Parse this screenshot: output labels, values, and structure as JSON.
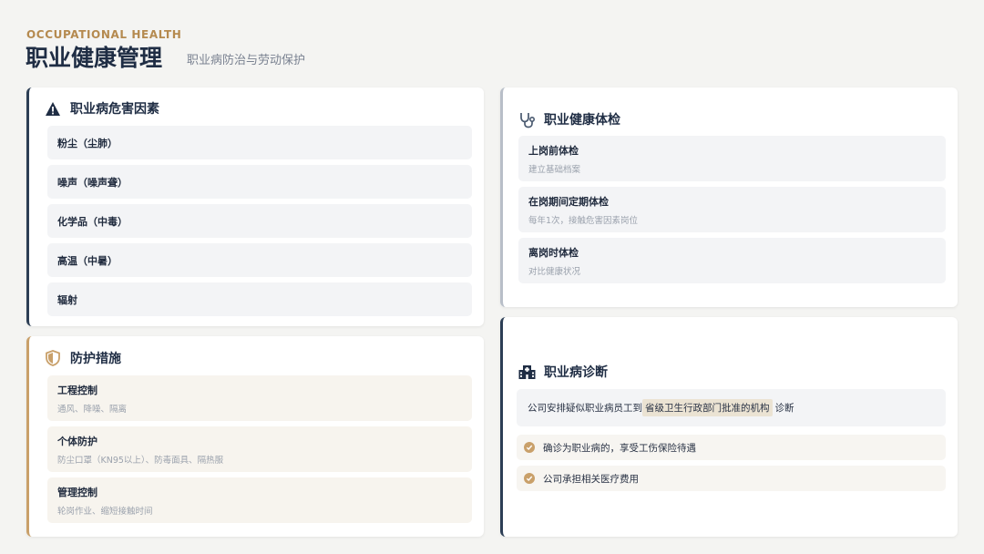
{
  "header": {
    "eyebrow": "OCCUPATIONAL HEALTH",
    "title": "职业健康管理",
    "subtitle": "职业病防治与劳动保护"
  },
  "hazards": {
    "title": "职业病危害因素",
    "icon": "warning-icon",
    "items": [
      "粉尘（尘肺）",
      "噪声（噪声聋）",
      "化学品（中毒）",
      "高温（中暑）",
      "辐射"
    ]
  },
  "protection": {
    "title": "防护措施",
    "icon": "shield-icon",
    "items": [
      {
        "title": "工程控制",
        "desc": "通风、降噪、隔离"
      },
      {
        "title": "个体防护",
        "desc": "防尘口罩（KN95以上）、防毒面具、隔热服"
      },
      {
        "title": "管理控制",
        "desc": "轮岗作业、缩短接触时间"
      }
    ]
  },
  "exam": {
    "title": "职业健康体检",
    "icon": "stethoscope-icon",
    "items": [
      {
        "title": "上岗前体检",
        "desc": "建立基础档案"
      },
      {
        "title": "在岗期间定期体检",
        "desc": "每年1次，接触危害因素岗位"
      },
      {
        "title": "离岗时体检",
        "desc": "对比健康状况"
      }
    ]
  },
  "diagnosis": {
    "title": "职业病诊断",
    "icon": "hospital-icon",
    "notice_before": "公司安排疑似职业病员工到",
    "notice_highlight": "省级卫生行政部门批准的机构",
    "notice_after": "诊断",
    "bullets": [
      "确诊为职业病的，享受工伤保险待遇",
      "公司承担相关医疗费用"
    ]
  },
  "colors": {
    "navy": "#1f2d44",
    "gold": "#c9a06a",
    "gray_border": "#b8bec8",
    "background": "#f4f4f2"
  }
}
